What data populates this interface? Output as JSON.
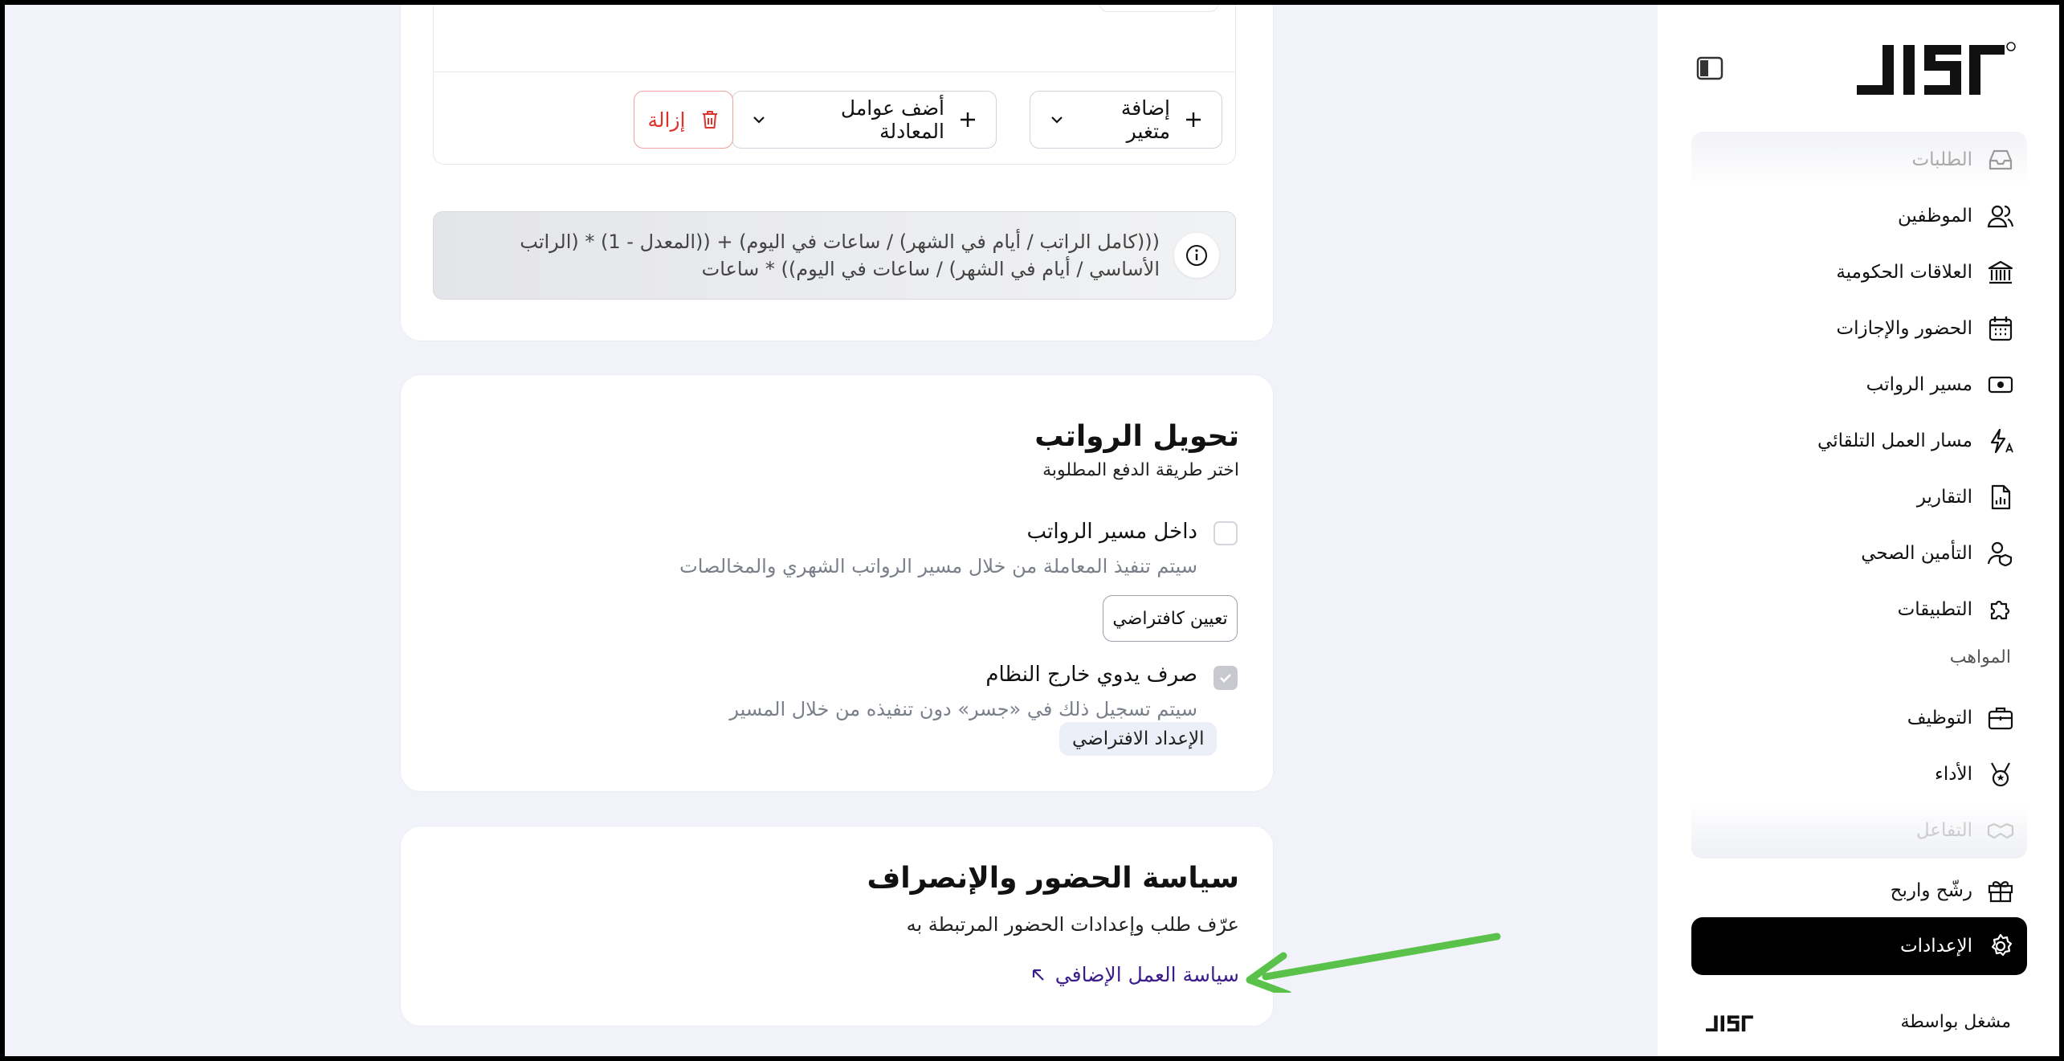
{
  "editor": {
    "add_variable_label": "إضافة متغير",
    "add_operators_label": "أضف عوامل المعادلة",
    "remove_label": "إزالة",
    "formula_text": "(((كامل الراتب / أيام في الشهر) / ساعات في اليوم) + ((المعدل - 1) * (الراتب الأساسي / أيام في الشهر) / ساعات في اليوم)) * ساعات"
  },
  "transfer": {
    "title": "تحويل الرواتب",
    "subtitle": "اختر طريقة الدفع المطلوبة",
    "options": [
      {
        "label": "داخل مسير الرواتب",
        "desc": "سيتم تنفيذ المعاملة من خلال مسير الرواتب الشهري والمخالصات",
        "checked": false,
        "action": "تعيين كافتراضي"
      },
      {
        "label": "صرف يدوي خارج النظام",
        "desc": "سيتم تسجيل ذلك في «جسر» دون تنفيذه من خلال المسير",
        "checked": true,
        "badge": "الإعداد الافتراضي"
      }
    ]
  },
  "attendance": {
    "title": "سياسة الحضور والإنصراف",
    "subtitle": "عرّف طلب وإعدادات الحضور المرتبطة به",
    "link_label": "سياسة العمل الإضافي"
  },
  "sidebar": {
    "items": [
      {
        "label": "الطلبات",
        "icon": "inbox-icon"
      },
      {
        "label": "الموظفين",
        "icon": "users-icon"
      },
      {
        "label": "العلاقات الحكومية",
        "icon": "bank-icon"
      },
      {
        "label": "الحضور والإجازات",
        "icon": "calendar-icon"
      },
      {
        "label": "مسير الرواتب",
        "icon": "cash-icon"
      },
      {
        "label": "مسار العمل التلقائي",
        "icon": "automation-icon"
      },
      {
        "label": "التقارير",
        "icon": "report-icon"
      },
      {
        "label": "التأمين الصحي",
        "icon": "insurance-icon"
      },
      {
        "label": "التطبيقات",
        "icon": "puzzle-icon"
      }
    ],
    "section_talent": "المواهب",
    "talent_items": [
      {
        "label": "التوظيف",
        "icon": "briefcase-icon"
      },
      {
        "label": "الأداء",
        "icon": "medal-icon"
      },
      {
        "label": "التفاعل",
        "icon": "handshake-icon"
      },
      {
        "label": "رشّح واربح",
        "icon": "gift-icon"
      }
    ],
    "settings_label": "الإعدادات",
    "powered_by": "مشغل بواسطة"
  },
  "colors": {
    "accent_link": "#3b1c8c",
    "danger": "#e0322d",
    "annotation_arrow": "#5ac24a"
  }
}
